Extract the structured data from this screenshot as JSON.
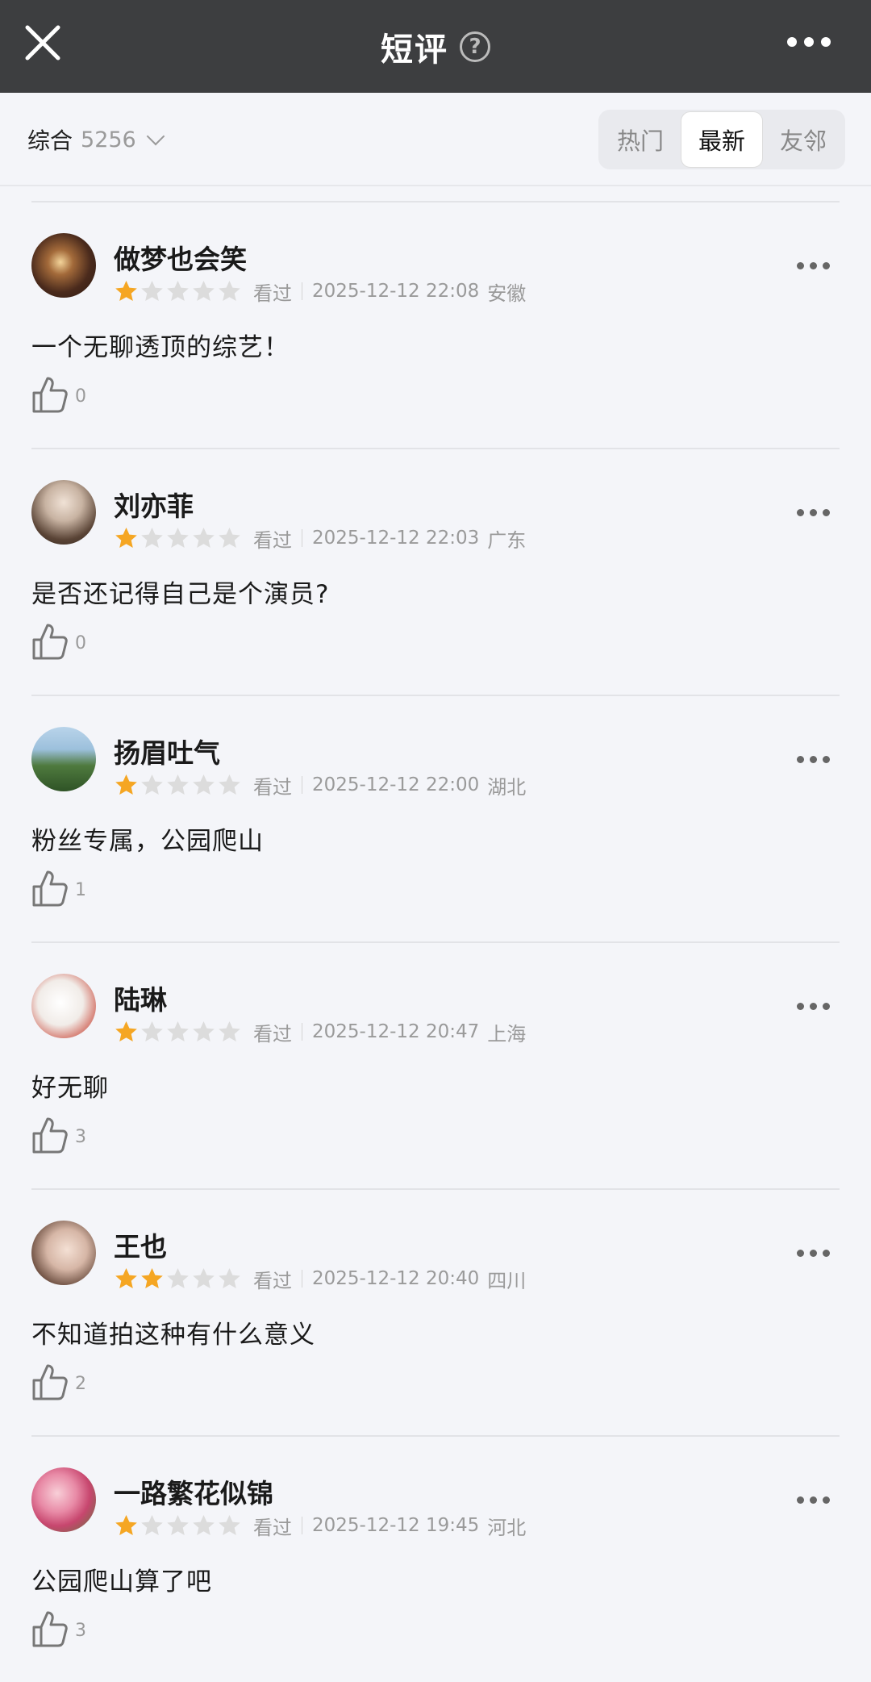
{
  "header": {
    "title": "短评",
    "help": "?"
  },
  "filter": {
    "sort_label": "综合",
    "count": "5256",
    "tabs": [
      "热门",
      "最新",
      "友邻"
    ],
    "active_tab": "最新"
  },
  "colors": {
    "star_on": "#f5a623",
    "star_off": "#dcdcdc",
    "topbar": "#3d3e40"
  },
  "reviews": [
    {
      "name": "做梦也会笑",
      "rating": 1,
      "seen": "看过",
      "time": "2025-12-12 22:08",
      "location": "安徽",
      "content": "一个无聊透顶的综艺！",
      "likes": "0"
    },
    {
      "name": "刘亦菲",
      "rating": 1,
      "seen": "看过",
      "time": "2025-12-12 22:03",
      "location": "广东",
      "content": "是否还记得自己是个演员?",
      "likes": "0"
    },
    {
      "name": "扬眉吐气",
      "rating": 1,
      "seen": "看过",
      "time": "2025-12-12 22:00",
      "location": "湖北",
      "content": "粉丝专属，公园爬山",
      "likes": "1"
    },
    {
      "name": "陆琳",
      "rating": 1,
      "seen": "看过",
      "time": "2025-12-12 20:47",
      "location": "上海",
      "content": "好无聊",
      "likes": "3"
    },
    {
      "name": "王也",
      "rating": 2,
      "seen": "看过",
      "time": "2025-12-12 20:40",
      "location": "四川",
      "content": "不知道拍这种有什么意义",
      "likes": "2"
    },
    {
      "name": "一路繁花似锦",
      "rating": 1,
      "seen": "看过",
      "time": "2025-12-12 19:45",
      "location": "河北",
      "content": "公园爬山算了吧",
      "likes": "3"
    }
  ]
}
